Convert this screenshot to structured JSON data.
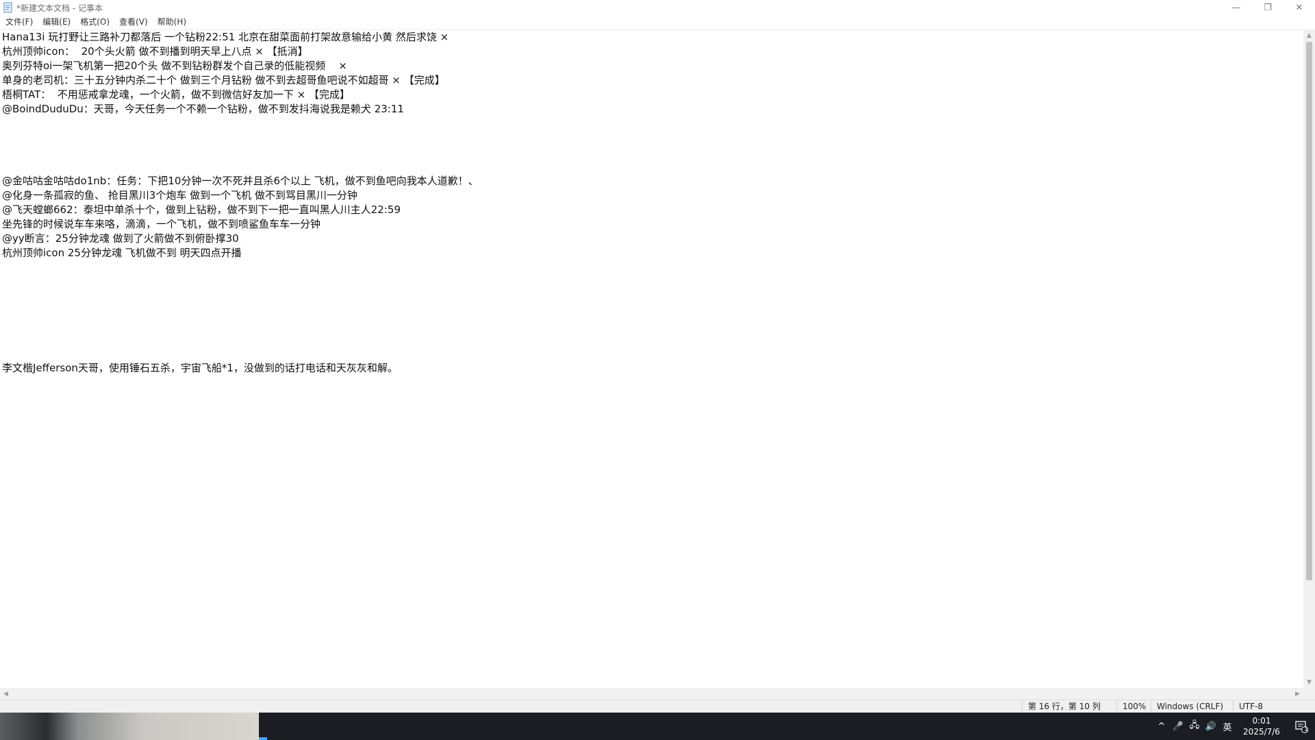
{
  "window": {
    "title": "*新建文本文档 - 记事本",
    "controls": {
      "minimize": "—",
      "restore": "❐",
      "close": "✕"
    }
  },
  "menu": [
    "文件(F)",
    "编辑(E)",
    "格式(O)",
    "查看(V)",
    "帮助(H)"
  ],
  "editor": {
    "lines": [
      "Hana13i 玩打野让三路补刀都落后 一个钻粉22:51 北京在甜菜面前打架故意输给小黄 然后求饶 ×",
      "杭州顶帅icon：  20个头火箭 做不到播到明天早上八点 × 【抵消】",
      "奥列芬特oi一架飞机第一把20个头 做不到钻粉群发个自己录的低能视频    ×",
      "单身的老司机：三十五分钟内杀二十个 做到三个月钻粉 做不到去超哥鱼吧说不如超哥 × 【完成】",
      "梧桐TAT：  不用惩戒拿龙魂，一个火箭，做不到微信好友加一下 × 【完成】",
      "@BoindDuduDu：天哥，今天任务一个不赖一个钻粉，做不到发抖海说我是赖犬 23:11",
      "",
      "",
      "",
      "",
      "@金咕咕金咕咕do1nb：任务：下把10分钟一次不死并且杀6个以上 飞机，做不到鱼吧向我本人道歉！、",
      "@化身一条孤寂的鱼、 抢目黑川3个炮车 做到一个飞机 做不到骂目黑川一分钟",
      "@飞天螳螂662：泰坦中单杀十个，做到上钻粉，做不到下一把一直叫黑人川主人22:59",
      "坐先锋的时候说车车来咯，滴滴，一个飞机，做不到喷鲨鱼车车一分钟",
      "@yy断言：25分钟龙魂 做到了火箭做不到俯卧撑30",
      "杭州顶帅icon 25分钟龙魂 飞机做不到 明天四点开播",
      "",
      "",
      "",
      "",
      "",
      "",
      "",
      "李文楷Jefferson天哥，使用锤石五杀，宇宙飞船*1，没做到的话打电话和天灰灰和解。"
    ]
  },
  "scrollbars": {
    "up": "▲",
    "down": "▼",
    "left": "◀",
    "right": "▶"
  },
  "status": {
    "position": "第 16 行，第 10 列",
    "zoom": "100%",
    "line_ending": "Windows (CRLF)",
    "encoding": "UTF-8"
  },
  "taskbar": {
    "tray": {
      "chevron": "^",
      "mic": "🎤",
      "network": "🖧",
      "volume": "🔊",
      "ime": "英"
    },
    "clock": {
      "time": "0:01",
      "date": "2025/7/6"
    },
    "notification_count": "1"
  }
}
